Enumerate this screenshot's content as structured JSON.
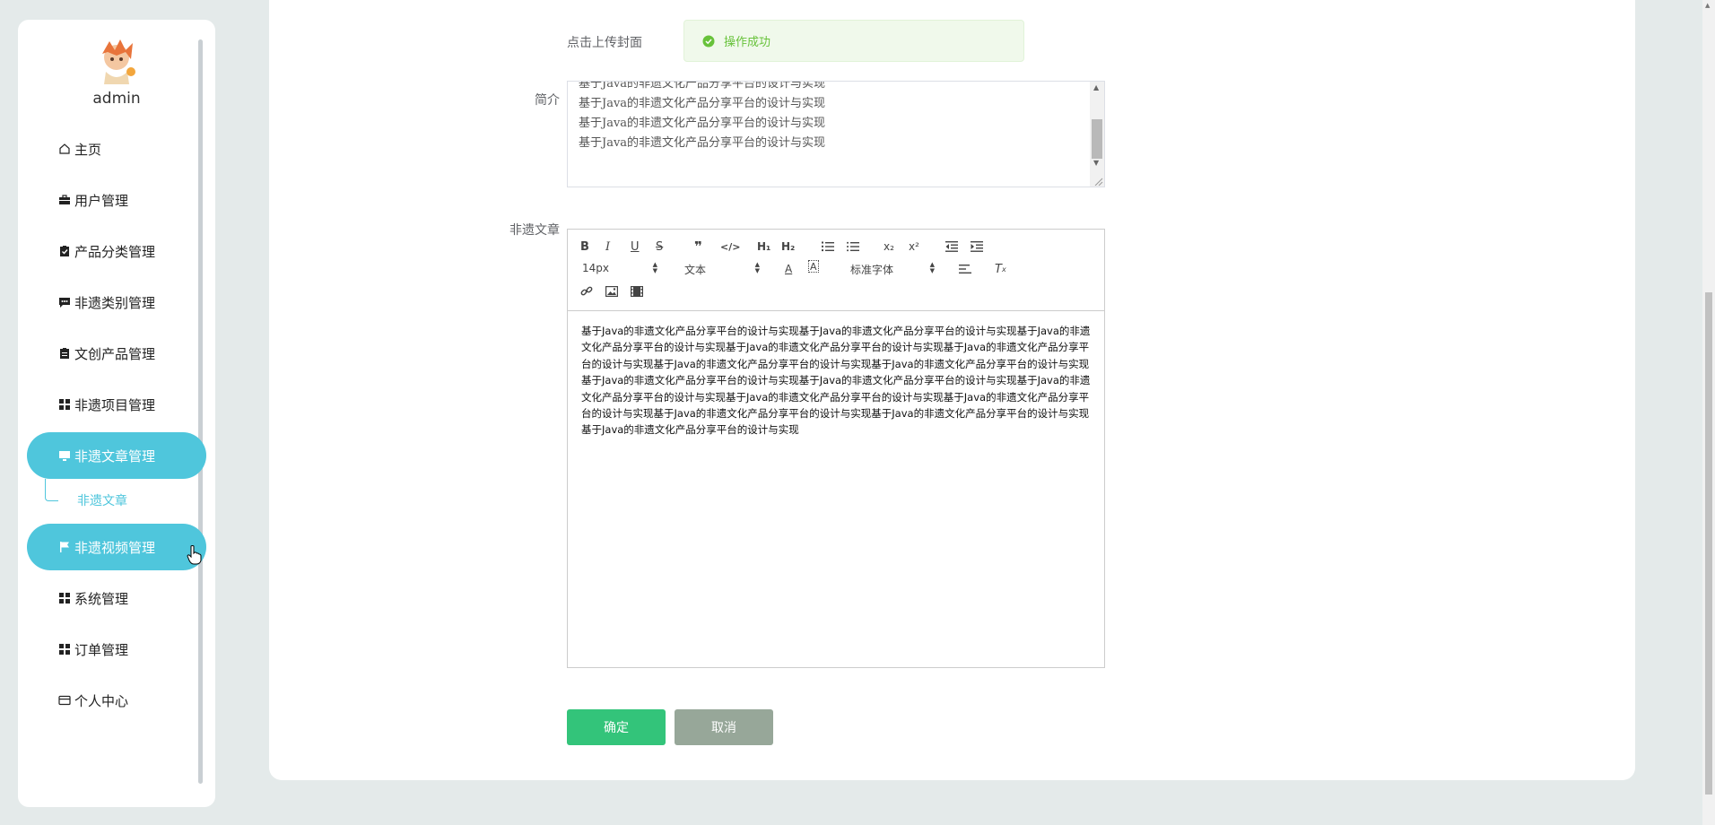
{
  "sidebar": {
    "user_name": "admin",
    "menu": [
      {
        "label": "主页",
        "icon": "home-icon"
      },
      {
        "label": "用户管理",
        "icon": "briefcase-icon"
      },
      {
        "label": "产品分类管理",
        "icon": "clipboard-check-icon"
      },
      {
        "label": "非遗类别管理",
        "icon": "chat-icon"
      },
      {
        "label": "文创产品管理",
        "icon": "clipboard-icon"
      },
      {
        "label": "非遗项目管理",
        "icon": "grid-icon"
      },
      {
        "label": "非遗文章管理",
        "icon": "monitor-icon",
        "active": true
      },
      {
        "label": "非遗视频管理",
        "icon": "flag-icon",
        "active": true
      },
      {
        "label": "系统管理",
        "icon": "grid-icon"
      },
      {
        "label": "订单管理",
        "icon": "grid-icon"
      },
      {
        "label": "个人中心",
        "icon": "card-icon"
      }
    ],
    "submenu_label": "非遗文章"
  },
  "form": {
    "cover_label": "点击上传封面",
    "toast_text": "操作成功",
    "intro_label": "简介",
    "intro_lines": [
      "基于Java的非遗文化产品分享平台的设计与实现",
      "基于Java的非遗文化产品分享平台的设计与实现",
      "基于Java的非遗文化产品分享平台的设计与实现",
      "基于Java的非遗文化产品分享平台的设计与实现"
    ],
    "article_label": "非遗文章",
    "editor": {
      "font_size": "14px",
      "paragraph": "文本",
      "font_family": "标准字体",
      "content": "基于Java的非遗文化产品分享平台的设计与实现基于Java的非遗文化产品分享平台的设计与实现基于Java的非遗文化产品分享平台的设计与实现基于Java的非遗文化产品分享平台的设计与实现基于Java的非遗文化产品分享平台的设计与实现基于Java的非遗文化产品分享平台的设计与实现基于Java的非遗文化产品分享平台的设计与实现基于Java的非遗文化产品分享平台的设计与实现基于Java的非遗文化产品分享平台的设计与实现基于Java的非遗文化产品分享平台的设计与实现基于Java的非遗文化产品分享平台的设计与实现基于Java的非遗文化产品分享平台的设计与实现基于Java的非遗文化产品分享平台的设计与实现基于Java的非遗文化产品分享平台的设计与实现基于Java的非遗文化产品分享平台的设计与实现"
    },
    "confirm_label": "确定",
    "cancel_label": "取消"
  },
  "colors": {
    "accent": "#4fc6dc",
    "confirm": "#33c47a",
    "cancel": "#97a799",
    "success": "#67c23a"
  }
}
